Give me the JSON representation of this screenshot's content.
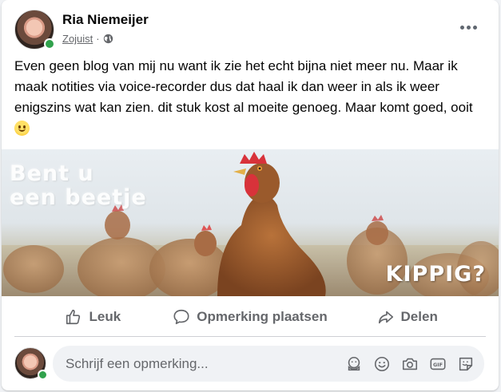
{
  "post": {
    "author": "Ria Niemeijer",
    "time": "Zojuist",
    "separator": "·",
    "audience_icon": "globe-icon",
    "text": "Even geen blog van mij nu want ik zie het echt bijna niet meer nu. Maar ik maak notities via voice-recorder dus dat haal ik dan weer in als ik weer enigszins wat kan zien. dit stuk kost al moeite genoeg. Maar komt goed, ooit",
    "text_emoji": "slightly-smiling-face-icon"
  },
  "photo": {
    "caption_top_line1": "Bent u",
    "caption_top_line2": "een beetje",
    "caption_bottom": "KIPPIG?"
  },
  "actions": {
    "like": "Leuk",
    "comment": "Opmerking plaatsen",
    "share": "Delen"
  },
  "comment_box": {
    "placeholder": "Schrijf een opmerking...",
    "icons": [
      "avatar-sticker-icon",
      "emoji-icon",
      "camera-icon",
      "gif-icon",
      "sticker-icon"
    ]
  },
  "colors": {
    "online": "#31a24c",
    "secondary_text": "#65676b",
    "input_bg": "#f0f2f5"
  }
}
